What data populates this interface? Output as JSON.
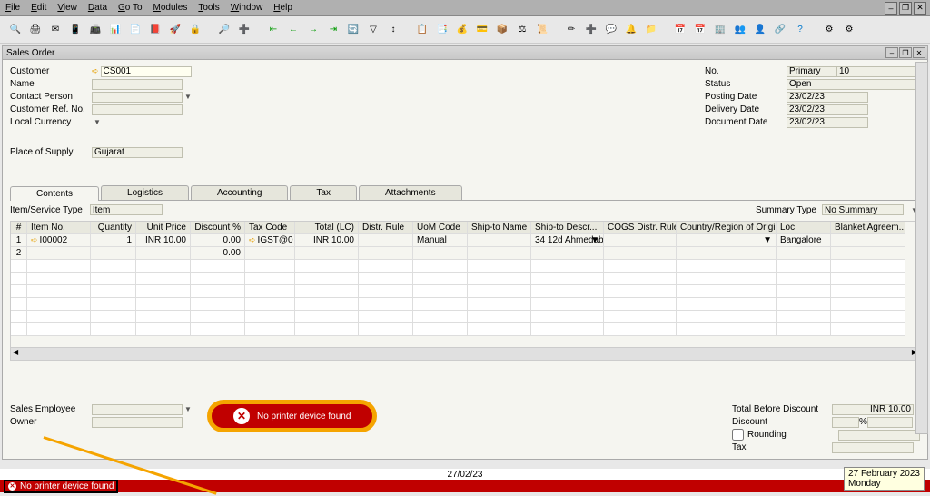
{
  "menu": [
    "File",
    "Edit",
    "View",
    "Data",
    "Go To",
    "Modules",
    "Tools",
    "Window",
    "Help"
  ],
  "window_title": "Sales Order",
  "header": {
    "customer_label": "Customer",
    "customer_value": "CS001",
    "name_label": "Name",
    "name_value": "",
    "contact_label": "Contact Person",
    "contact_value": "",
    "ref_label": "Customer Ref. No.",
    "ref_value": "",
    "currency_label": "Local Currency",
    "currency_value": "",
    "pos_label": "Place of Supply",
    "pos_value": "Gujarat"
  },
  "header_right": {
    "no_label": "No.",
    "no_kind": "Primary",
    "no_value": "10",
    "status_label": "Status",
    "status_value": "Open",
    "posting_label": "Posting Date",
    "posting_value": "23/02/23",
    "delivery_label": "Delivery Date",
    "delivery_value": "23/02/23",
    "doc_label": "Document Date",
    "doc_value": "23/02/23"
  },
  "tabs": [
    "Contents",
    "Logistics",
    "Accounting",
    "Tax",
    "Attachments"
  ],
  "item_type_label": "Item/Service Type",
  "item_type_value": "Item",
  "summary_type_label": "Summary Type",
  "summary_type_value": "No Summary",
  "grid": {
    "cols": [
      "#",
      "Item No.",
      "Quantity",
      "Unit Price",
      "Discount %",
      "Tax Code",
      "Total (LC)",
      "Distr. Rule",
      "UoM Code",
      "Ship-to Name",
      "Ship-to Descr...",
      "COGS Distr. Rule",
      "Country/Region of Origin",
      "Loc.",
      "Blanket Agreem..."
    ],
    "rows": [
      {
        "idx": "1",
        "item": "I00002",
        "qty": "1",
        "price": "INR 10.00",
        "disc": "0.00",
        "tax": "IGST@0",
        "total": "INR 10.00",
        "distr": "",
        "uom": "Manual",
        "ship": "",
        "shipd": "34 12d Ahmedab",
        "cogs": "",
        "country": "",
        "loc": "Bangalore",
        "bl": ""
      },
      {
        "idx": "2",
        "item": "",
        "qty": "",
        "price": "",
        "disc": "0.00",
        "tax": "",
        "total": "",
        "distr": "",
        "uom": "",
        "ship": "",
        "shipd": "",
        "cogs": "",
        "country": "",
        "loc": "",
        "bl": ""
      }
    ]
  },
  "footer_left": {
    "sales_emp_label": "Sales Employee",
    "sales_emp_value": "",
    "owner_label": "Owner",
    "owner_value": ""
  },
  "footer_right": {
    "tbd_label": "Total Before Discount",
    "tbd_value": "INR 10.00",
    "disc_label": "Discount",
    "disc_pct": "",
    "disc_pct_suffix": "%",
    "disc_value": "",
    "round_label": "Rounding",
    "round_value": "",
    "tax_label": "Tax",
    "tax_value": ""
  },
  "error_text": "No printer device found",
  "status_date": "27/02/23",
  "tooltip_date": "27 February 2023",
  "tooltip_day": "Monday"
}
